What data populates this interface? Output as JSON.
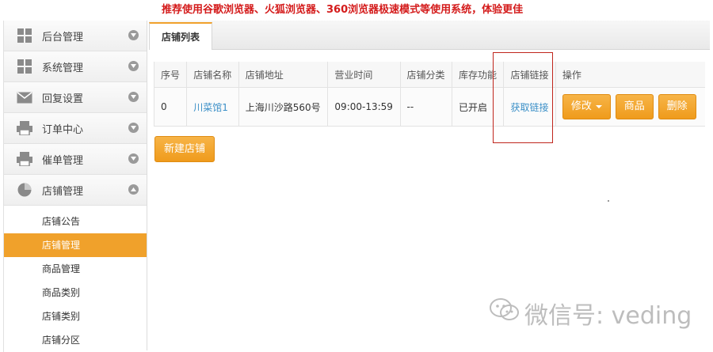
{
  "notice": "推荐使用谷歌浏览器、火狐浏览器、360浏览器极速模式等使用系统，体验更佳",
  "sidebar": {
    "items": [
      {
        "label": "后台管理",
        "icon": "grid-icon"
      },
      {
        "label": "系统管理",
        "icon": "grid-icon"
      },
      {
        "label": "回复设置",
        "icon": "envelope-icon"
      },
      {
        "label": "订单中心",
        "icon": "printer-icon"
      },
      {
        "label": "催单管理",
        "icon": "printer-icon"
      },
      {
        "label": "店铺管理",
        "icon": "pie-chart-icon"
      }
    ],
    "submenu": [
      {
        "label": "店铺公告"
      },
      {
        "label": "店铺管理",
        "active": true
      },
      {
        "label": "商品管理"
      },
      {
        "label": "商品类别"
      },
      {
        "label": "店铺类别"
      },
      {
        "label": "店铺分区"
      }
    ]
  },
  "tab": {
    "label": "店铺列表"
  },
  "table": {
    "headers": [
      "序号",
      "店铺名称",
      "店铺地址",
      "营业时间",
      "店铺分类",
      "库存功能",
      "店铺链接",
      "操作"
    ],
    "rows": [
      {
        "index": "0",
        "name": "川菜馆1",
        "address": "上海川沙路560号",
        "hours": "09:00-13:59",
        "category": "--",
        "inventory": "已开启",
        "link": "获取链接",
        "actions": {
          "edit": "修改",
          "goods": "商品",
          "delete": "删除"
        }
      }
    ]
  },
  "add_button": "新建店铺",
  "watermark": "微信号: veding",
  "colors": {
    "accent": "#f0a12b",
    "notice": "#d41b1b",
    "link": "#3a8fc7",
    "highlight": "#c0261d"
  }
}
